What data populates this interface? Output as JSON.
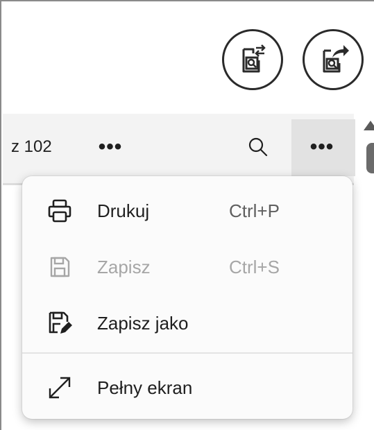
{
  "header": {
    "buttons": [
      {
        "icon": "document-compare-icon"
      },
      {
        "icon": "document-share-icon"
      }
    ]
  },
  "toolbar": {
    "page_count": "z 102",
    "more_left_label": "•••",
    "search_icon": "search-icon",
    "more_right_label": "•••"
  },
  "menu": {
    "items": [
      {
        "label": "Drukuj",
        "shortcut": "Ctrl+P",
        "icon": "printer-icon",
        "enabled": true
      },
      {
        "label": "Zapisz",
        "shortcut": "Ctrl+S",
        "icon": "save-icon",
        "enabled": false
      },
      {
        "label": "Zapisz jako",
        "shortcut": "",
        "icon": "save-as-icon",
        "enabled": true
      },
      {
        "label": "Pełny ekran",
        "shortcut": "",
        "icon": "fullscreen-icon",
        "enabled": true
      }
    ]
  },
  "colors": {
    "text": "#1f1f1f",
    "disabled_text": "#a6a6a6",
    "toolbar_bg": "#f3f3f3",
    "menu_bg": "#fbfbfb"
  }
}
